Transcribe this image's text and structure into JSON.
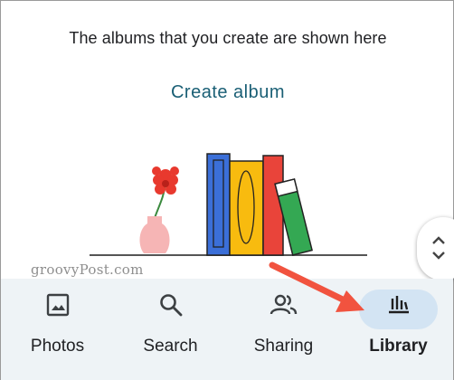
{
  "empty_state": {
    "message": "The albums that you create are shown here",
    "create_album_label": "Create album"
  },
  "watermark": "groovyPost.com",
  "nav": {
    "items": [
      {
        "label": "Photos",
        "icon": "photo-icon",
        "active": false
      },
      {
        "label": "Search",
        "icon": "search-icon",
        "active": false
      },
      {
        "label": "Sharing",
        "icon": "people-icon",
        "active": false
      },
      {
        "label": "Library",
        "icon": "library-icon",
        "active": true
      }
    ]
  },
  "colors": {
    "accent_text": "#1a5f75",
    "active_pill": "#d3e4f3",
    "nav_background": "#eef3f6",
    "annotation_arrow": "#f1533f"
  }
}
